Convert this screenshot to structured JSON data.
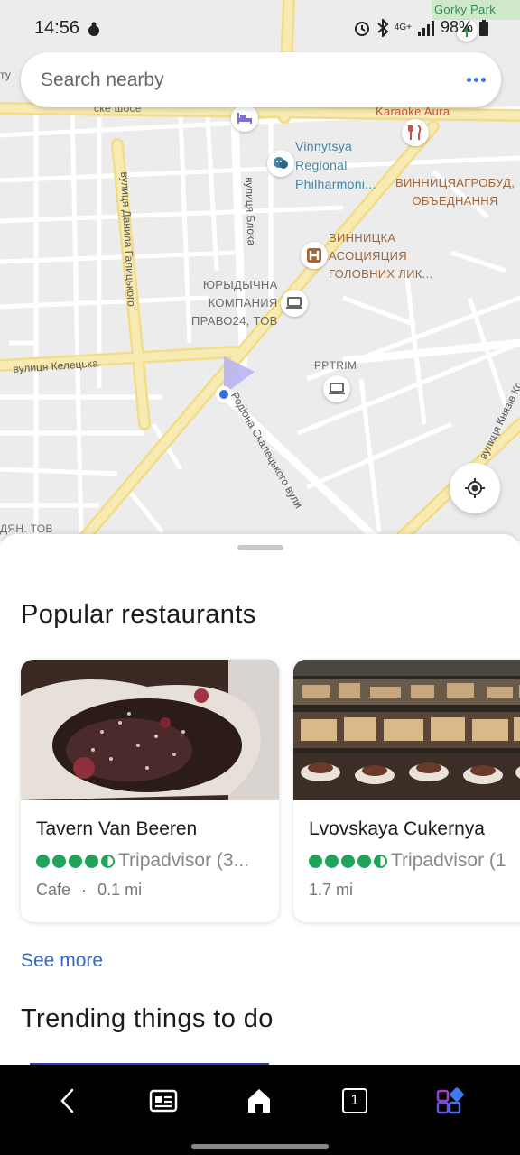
{
  "status_bar": {
    "time": "14:56",
    "battery": "98%",
    "network": "4G+"
  },
  "search": {
    "placeholder": "Search nearby",
    "more_icon": "more-dots-icon"
  },
  "map": {
    "labels": {
      "gorky_park": "Gorky Park",
      "karaoke": "Karaoke Aura",
      "philharmonic": [
        "Vinnytsya",
        "Regional",
        "Philharmoni..."
      ],
      "vinnytsia_agro": [
        "ВИННИЦЯАГРОБУД,",
        "ОБЪЕДНАННЯ"
      ],
      "association": [
        "ВИННИЦКА",
        "АСОЦИЯЦИЯ",
        "ГОЛОВНИХ ЛИК..."
      ],
      "law_company": [
        "ЮРЫДЫЧНА",
        "КОМПАНИЯ",
        "ПРАВО24, ТОВ"
      ],
      "prtrim": "PPTRIM",
      "partial_left_top": "ту",
      "partial_left_bottom": "ДЯН. ТОВ",
      "partial_highway": "ске шосе"
    },
    "streets": {
      "danyla": "вулиця Данила Галицького",
      "bloka": "вулиця Блока",
      "keletska": "вулиця Келецька",
      "skaletskoho": "Родіона Скалецького вули",
      "knyaziv": "вулиця Князів Ко"
    },
    "locate_icon": "my-location-icon"
  },
  "sheet": {
    "popular_title": "Popular restaurants",
    "restaurants": [
      {
        "name": "Tavern Van Beeren",
        "rating": 4.5,
        "source": "Tripadvisor (3...",
        "category": "Cafe",
        "separator": "·",
        "distance": "0.1 mi"
      },
      {
        "name": "Lvovskaya Cukernya",
        "rating": 4.5,
        "source": "Tripadvisor (1",
        "distance": "1.7 mi"
      }
    ],
    "see_more": "See more",
    "trending_title": "Trending things to do"
  },
  "nav": {
    "tabs_count": "1"
  },
  "colors": {
    "accent_blue": "#3468c2",
    "rating_green": "#1fa45a",
    "road_yellow": "#f6e59a"
  }
}
